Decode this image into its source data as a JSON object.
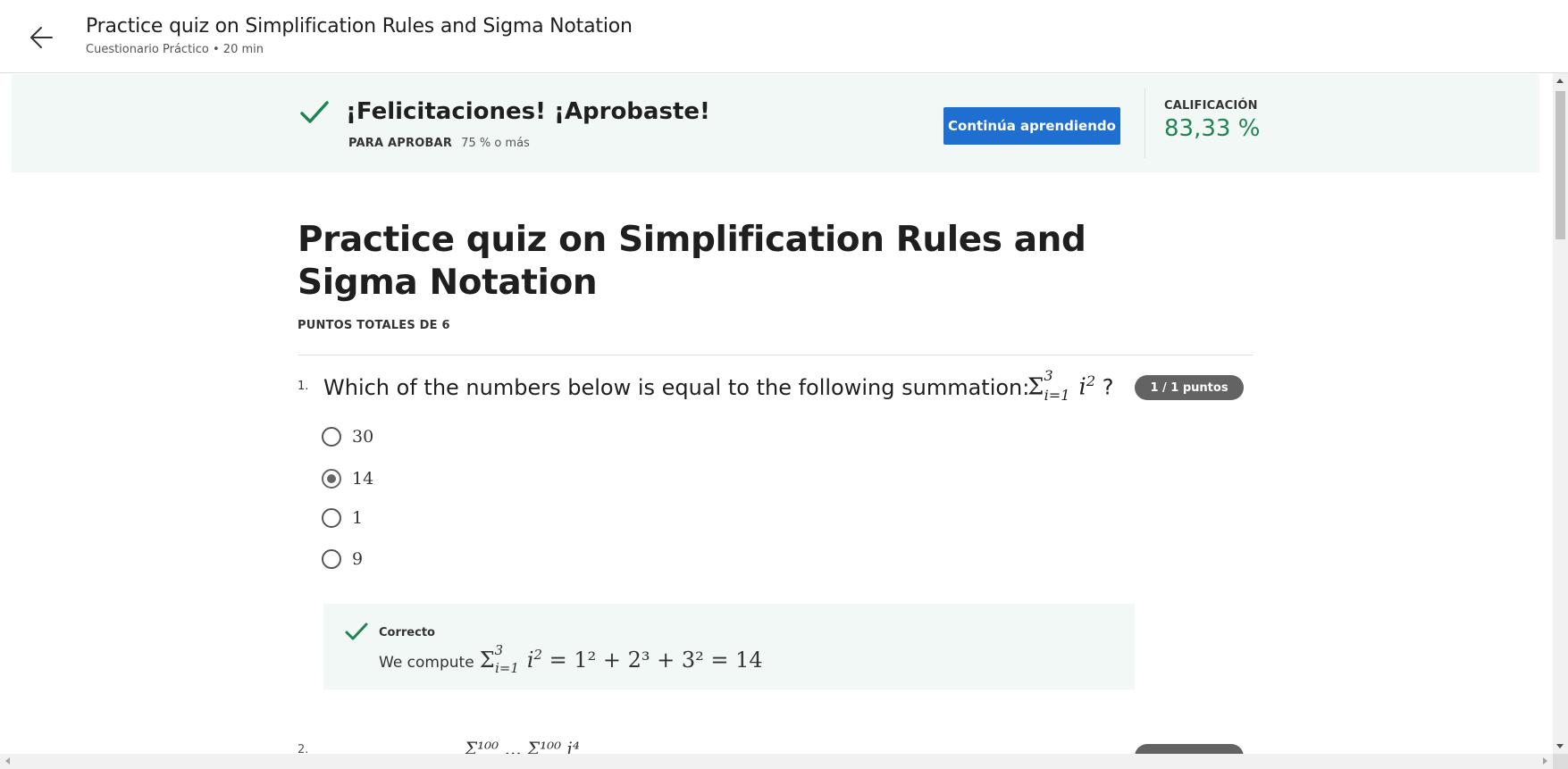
{
  "header": {
    "title": "Practice quiz on Simplification Rules and Sigma Notation",
    "subtitle": "Cuestionario Práctico • 20 min",
    "back_icon": "arrow-left-icon"
  },
  "banner": {
    "title": "¡Felicitaciones! ¡Aprobaste!",
    "pass_label": "PARA APROBAR",
    "pass_value": "75 % o más",
    "continue_label": "Continúa aprendiendo",
    "grade_label": "CALIFICACIÓN",
    "grade_value": "83,33 %",
    "colors": {
      "accent_green": "#1f8354",
      "button_blue": "#1f6fd0",
      "banner_bg": "#f2f8f6"
    }
  },
  "main": {
    "title": "Practice quiz on Simplification Rules and Sigma Notation",
    "points_total": "PUNTOS TOTALES DE 6"
  },
  "question1": {
    "number": "1.",
    "text": "Which of the numbers below is equal to the following summation:",
    "formula_sigma": "Σ",
    "formula_sub": "i=1",
    "formula_sup": "3",
    "formula_var": "i",
    "formula_pow": "2",
    "formula_end": " ?",
    "points": "1 / 1 puntos",
    "options": [
      {
        "label": "30",
        "selected": false
      },
      {
        "label": "14",
        "selected": true
      },
      {
        "label": "1",
        "selected": false
      },
      {
        "label": "9",
        "selected": false
      }
    ],
    "feedback": {
      "status": "Correcto",
      "text": "We compute",
      "formula_tail": " = 1",
      "rhs": "= 1² + 2³ + 3² = 14"
    }
  },
  "question2_peek": {
    "number": "2.",
    "formula_text": "Σ¹⁰⁰ ... Σ¹⁰⁰ i⁴"
  }
}
